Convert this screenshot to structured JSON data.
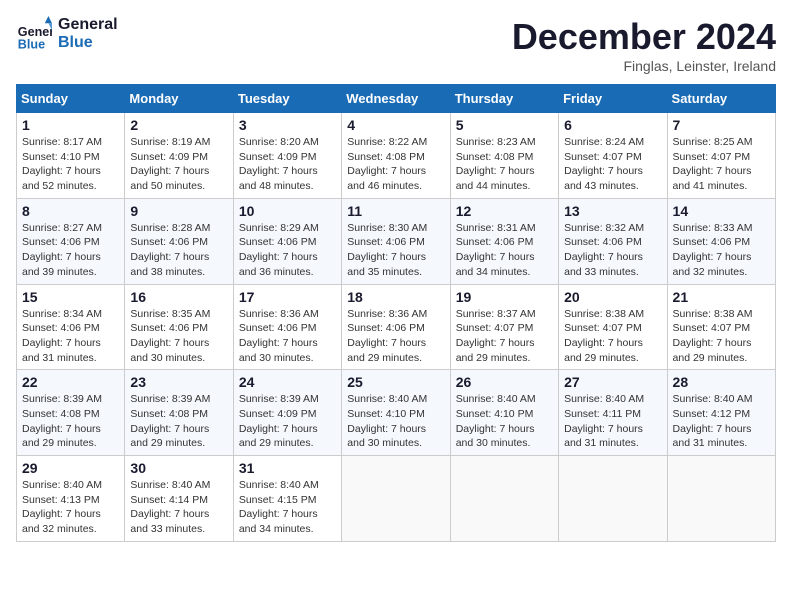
{
  "header": {
    "logo_line1": "General",
    "logo_line2": "Blue",
    "month_title": "December 2024",
    "subtitle": "Finglas, Leinster, Ireland"
  },
  "days_of_week": [
    "Sunday",
    "Monday",
    "Tuesday",
    "Wednesday",
    "Thursday",
    "Friday",
    "Saturday"
  ],
  "weeks": [
    [
      {
        "day": "1",
        "sunrise": "8:17 AM",
        "sunset": "4:10 PM",
        "daylight": "7 hours and 52 minutes."
      },
      {
        "day": "2",
        "sunrise": "8:19 AM",
        "sunset": "4:09 PM",
        "daylight": "7 hours and 50 minutes."
      },
      {
        "day": "3",
        "sunrise": "8:20 AM",
        "sunset": "4:09 PM",
        "daylight": "7 hours and 48 minutes."
      },
      {
        "day": "4",
        "sunrise": "8:22 AM",
        "sunset": "4:08 PM",
        "daylight": "7 hours and 46 minutes."
      },
      {
        "day": "5",
        "sunrise": "8:23 AM",
        "sunset": "4:08 PM",
        "daylight": "7 hours and 44 minutes."
      },
      {
        "day": "6",
        "sunrise": "8:24 AM",
        "sunset": "4:07 PM",
        "daylight": "7 hours and 43 minutes."
      },
      {
        "day": "7",
        "sunrise": "8:25 AM",
        "sunset": "4:07 PM",
        "daylight": "7 hours and 41 minutes."
      }
    ],
    [
      {
        "day": "8",
        "sunrise": "8:27 AM",
        "sunset": "4:06 PM",
        "daylight": "7 hours and 39 minutes."
      },
      {
        "day": "9",
        "sunrise": "8:28 AM",
        "sunset": "4:06 PM",
        "daylight": "7 hours and 38 minutes."
      },
      {
        "day": "10",
        "sunrise": "8:29 AM",
        "sunset": "4:06 PM",
        "daylight": "7 hours and 36 minutes."
      },
      {
        "day": "11",
        "sunrise": "8:30 AM",
        "sunset": "4:06 PM",
        "daylight": "7 hours and 35 minutes."
      },
      {
        "day": "12",
        "sunrise": "8:31 AM",
        "sunset": "4:06 PM",
        "daylight": "7 hours and 34 minutes."
      },
      {
        "day": "13",
        "sunrise": "8:32 AM",
        "sunset": "4:06 PM",
        "daylight": "7 hours and 33 minutes."
      },
      {
        "day": "14",
        "sunrise": "8:33 AM",
        "sunset": "4:06 PM",
        "daylight": "7 hours and 32 minutes."
      }
    ],
    [
      {
        "day": "15",
        "sunrise": "8:34 AM",
        "sunset": "4:06 PM",
        "daylight": "7 hours and 31 minutes."
      },
      {
        "day": "16",
        "sunrise": "8:35 AM",
        "sunset": "4:06 PM",
        "daylight": "7 hours and 30 minutes."
      },
      {
        "day": "17",
        "sunrise": "8:36 AM",
        "sunset": "4:06 PM",
        "daylight": "7 hours and 30 minutes."
      },
      {
        "day": "18",
        "sunrise": "8:36 AM",
        "sunset": "4:06 PM",
        "daylight": "7 hours and 29 minutes."
      },
      {
        "day": "19",
        "sunrise": "8:37 AM",
        "sunset": "4:07 PM",
        "daylight": "7 hours and 29 minutes."
      },
      {
        "day": "20",
        "sunrise": "8:38 AM",
        "sunset": "4:07 PM",
        "daylight": "7 hours and 29 minutes."
      },
      {
        "day": "21",
        "sunrise": "8:38 AM",
        "sunset": "4:07 PM",
        "daylight": "7 hours and 29 minutes."
      }
    ],
    [
      {
        "day": "22",
        "sunrise": "8:39 AM",
        "sunset": "4:08 PM",
        "daylight": "7 hours and 29 minutes."
      },
      {
        "day": "23",
        "sunrise": "8:39 AM",
        "sunset": "4:08 PM",
        "daylight": "7 hours and 29 minutes."
      },
      {
        "day": "24",
        "sunrise": "8:39 AM",
        "sunset": "4:09 PM",
        "daylight": "7 hours and 29 minutes."
      },
      {
        "day": "25",
        "sunrise": "8:40 AM",
        "sunset": "4:10 PM",
        "daylight": "7 hours and 30 minutes."
      },
      {
        "day": "26",
        "sunrise": "8:40 AM",
        "sunset": "4:10 PM",
        "daylight": "7 hours and 30 minutes."
      },
      {
        "day": "27",
        "sunrise": "8:40 AM",
        "sunset": "4:11 PM",
        "daylight": "7 hours and 31 minutes."
      },
      {
        "day": "28",
        "sunrise": "8:40 AM",
        "sunset": "4:12 PM",
        "daylight": "7 hours and 31 minutes."
      }
    ],
    [
      {
        "day": "29",
        "sunrise": "8:40 AM",
        "sunset": "4:13 PM",
        "daylight": "7 hours and 32 minutes."
      },
      {
        "day": "30",
        "sunrise": "8:40 AM",
        "sunset": "4:14 PM",
        "daylight": "7 hours and 33 minutes."
      },
      {
        "day": "31",
        "sunrise": "8:40 AM",
        "sunset": "4:15 PM",
        "daylight": "7 hours and 34 minutes."
      },
      null,
      null,
      null,
      null
    ]
  ],
  "labels": {
    "sunrise": "Sunrise:",
    "sunset": "Sunset:",
    "daylight": "Daylight:"
  }
}
